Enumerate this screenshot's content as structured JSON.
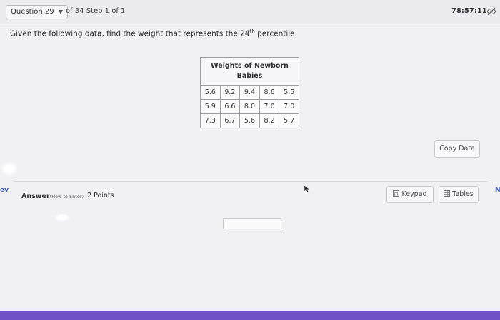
{
  "header": {
    "question_label": "Question 29",
    "step_text": "of 34 Step 1 of 1",
    "timer": "78:57:11"
  },
  "question": {
    "text_before": "Given the following data, find the weight that represents the 24",
    "sup": "th",
    "text_after": " percentile."
  },
  "table": {
    "title": "Weights of Newborn Babies",
    "rows": [
      [
        "5.6",
        "9.2",
        "9.4",
        "8.6",
        "5.5"
      ],
      [
        "5.9",
        "6.6",
        "8.0",
        "7.0",
        "7.0"
      ],
      [
        "7.3",
        "6.7",
        "5.6",
        "8.2",
        "5.7"
      ]
    ]
  },
  "buttons": {
    "copy_data": "Copy Data",
    "keypad": "Keypad",
    "tables": "Tables"
  },
  "nav": {
    "prev": "ev",
    "next": "N"
  },
  "answer": {
    "label": "Answer",
    "how_link": "(How to Enter)",
    "points": "2 Points",
    "input_value": ""
  }
}
